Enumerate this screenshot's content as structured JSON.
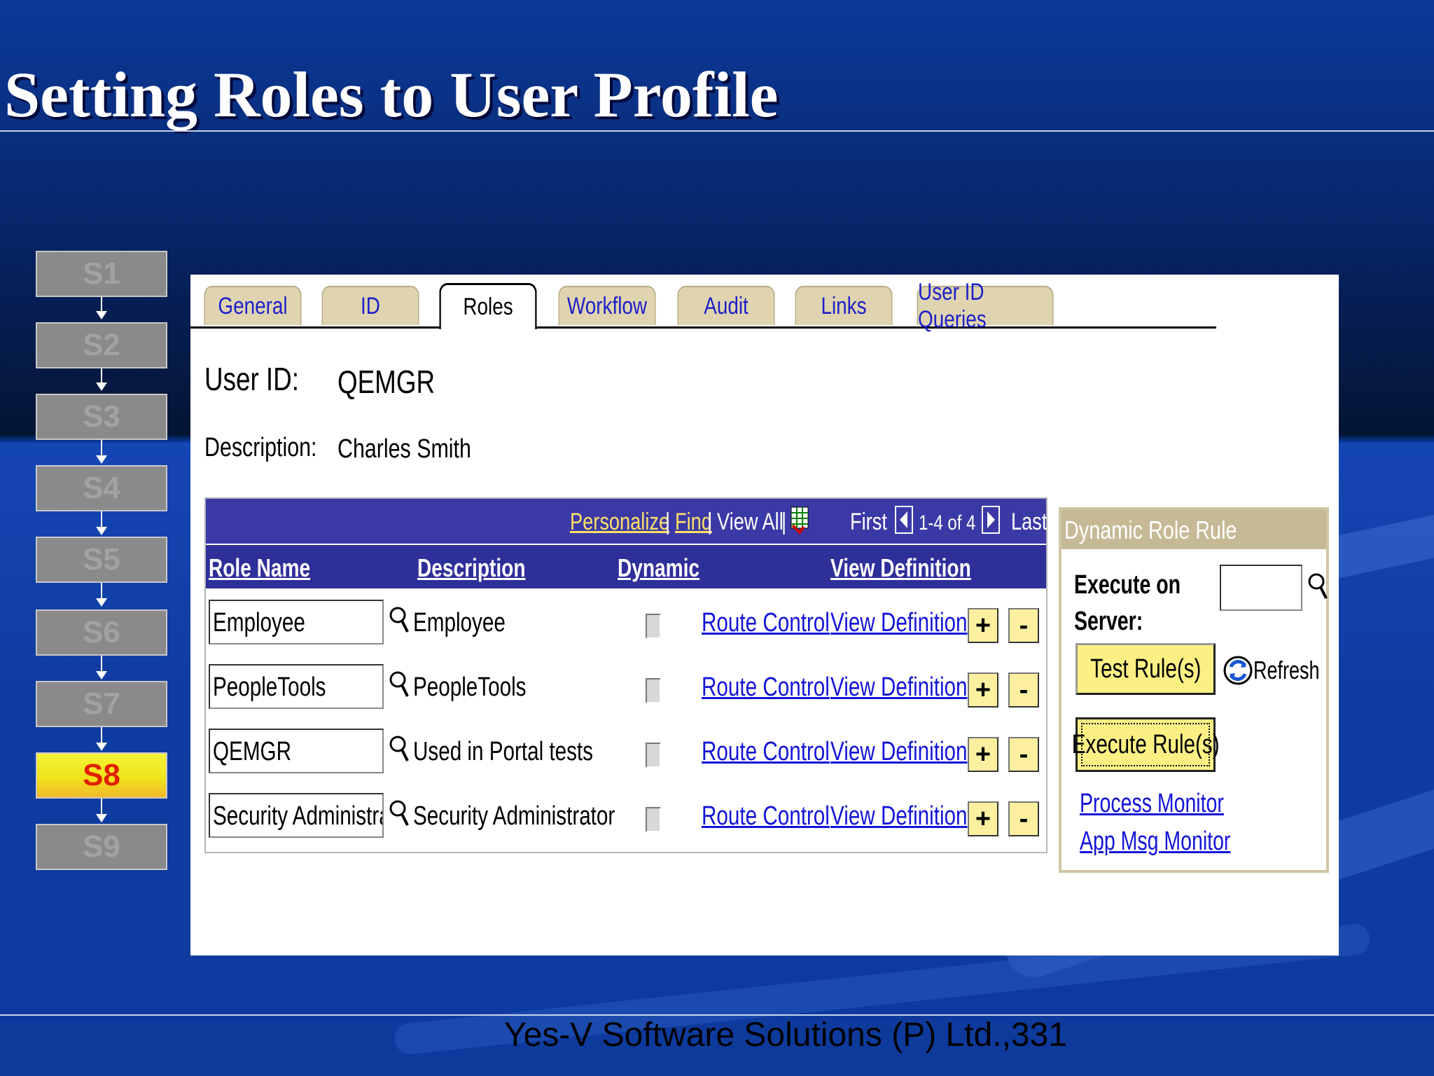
{
  "slide": {
    "title": "Setting Roles to User Profile",
    "footer": "Yes-V Software Solutions (P) Ltd.,331"
  },
  "steps": [
    {
      "label": "S1",
      "active": false
    },
    {
      "label": "S2",
      "active": false
    },
    {
      "label": "S3",
      "active": false
    },
    {
      "label": "S4",
      "active": false
    },
    {
      "label": "S5",
      "active": false
    },
    {
      "label": "S6",
      "active": false
    },
    {
      "label": "S7",
      "active": false
    },
    {
      "label": "S8",
      "active": true
    },
    {
      "label": "S9",
      "active": false
    }
  ],
  "tabs": [
    {
      "label": "General",
      "active": false
    },
    {
      "label": "ID",
      "active": false
    },
    {
      "label": "Roles",
      "active": true
    },
    {
      "label": "Workflow",
      "active": false
    },
    {
      "label": "Audit",
      "active": false
    },
    {
      "label": "Links",
      "active": false
    },
    {
      "label": "User ID Queries",
      "active": false
    }
  ],
  "profile": {
    "user_id_label": "User ID:",
    "user_id_value": "QEMGR",
    "description_label": "Description:",
    "description_value": "Charles Smith"
  },
  "grid": {
    "personalize": "Personalize",
    "sep1": "|",
    "find": "Find",
    "sep2": "|",
    "view_all": "View All",
    "sep3": "|",
    "first": "First",
    "range": "1-4 of 4",
    "last": "Last",
    "headers": {
      "role_name": "Role Name",
      "description": "Description",
      "dynamic": "Dynamic",
      "view_definition": "View Definition"
    },
    "rows": [
      {
        "role": "Employee",
        "description": "Employee",
        "dynamic": false,
        "route": "Route Control",
        "view": "View Definition"
      },
      {
        "role": "PeopleTools",
        "description": "PeopleTools",
        "dynamic": false,
        "route": "Route Control",
        "view": "View Definition"
      },
      {
        "role": "QEMGR",
        "description": "Used in Portal tests",
        "dynamic": false,
        "route": "Route Control",
        "view": "View Definition"
      },
      {
        "role": "Security Administrator",
        "description": "Security Administrator",
        "dynamic": false,
        "route": "Route Control",
        "view": "View Definition"
      }
    ],
    "add_label": "+",
    "remove_label": "-"
  },
  "dynamic_role_rule": {
    "title": "Dynamic Role Rule",
    "execute_on_label_1": "Execute on",
    "execute_on_label_2": "Server:",
    "execute_on_value": "",
    "test_rules": "Test Rule(s)",
    "refresh": "Refresh",
    "execute_rules": "Execute Rule(s)",
    "process_monitor": "Process Monitor",
    "app_msg_monitor": "App Msg Monitor"
  },
  "colors": {
    "tab_bg": "#e0d4b0",
    "grid_header": "#3b39a6",
    "link": "#1414d8",
    "button_yellow": "#fcf084",
    "active_step": "#f0e41a",
    "active_step_text": "#e02000"
  },
  "icons": {
    "lookup": "magnifier-icon",
    "download": "spreadsheet-download-icon",
    "prev": "arrow-left-icon",
    "next": "arrow-right-icon",
    "refresh": "refresh-icon"
  }
}
